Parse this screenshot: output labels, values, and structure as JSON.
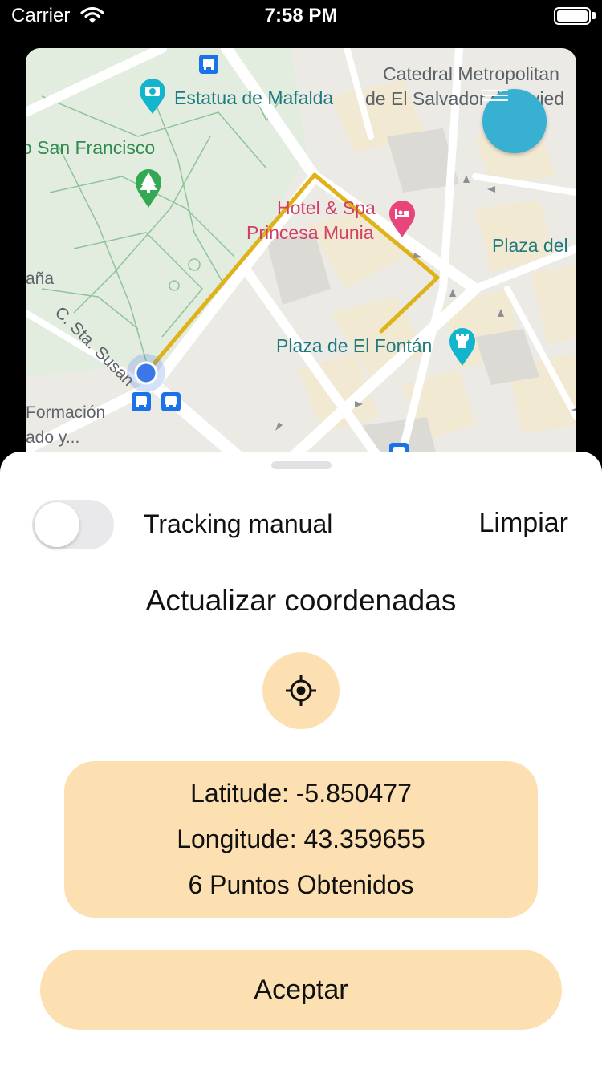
{
  "status_bar": {
    "carrier": "Carrier",
    "time": "7:58 PM"
  },
  "map": {
    "labels": {
      "statue": "Estatua de Mafalda",
      "cathedral_line1": "Catedral Metropolitan",
      "cathedral_line2": "de El Salvador de Ovied",
      "park": "o San Francisco",
      "hotel_line1": "Hotel & Spa",
      "hotel_line2": "Princesa Munia",
      "plaza_del": "Plaza del",
      "partial_left": "aña",
      "street": "C. Sta. Susan",
      "plaza_fontan": "Plaza de El Fontán",
      "formacion_line1": "Formación",
      "formacion_line2": "ado y..."
    },
    "icons": [
      "camera-pin-icon",
      "tree-pin-icon",
      "bed-pin-icon",
      "castle-pin-icon",
      "bus-stop-icon",
      "user-location-dot-icon"
    ],
    "colors": {
      "route": "#e0b21a",
      "user_dot": "#3b78e7",
      "fab": "#38b0d1"
    }
  },
  "sheet": {
    "tracking_label": "Tracking manual",
    "tracking_enabled": false,
    "clear_label": "Limpiar",
    "title": "Actualizar coordenadas",
    "latitude_text": "Latitude: -5.850477",
    "longitude_text": "Longitude: 43.359655",
    "points_text": "6 Puntos Obtenidos",
    "accept_label": "Aceptar",
    "accent_color": "#fde0b2"
  }
}
